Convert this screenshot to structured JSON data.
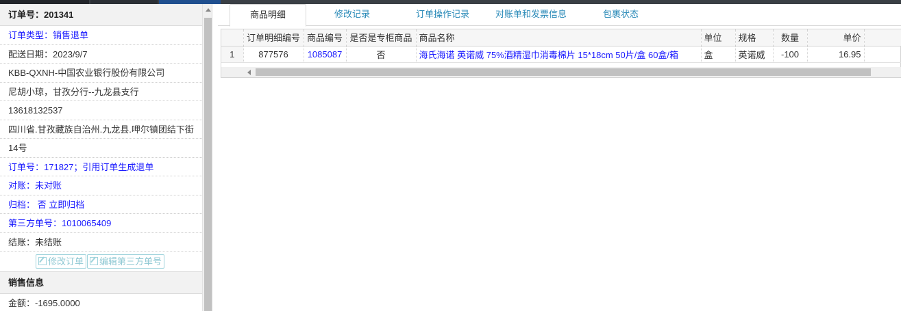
{
  "order_panel": {
    "header": "订单号：201341",
    "rows": [
      {
        "text": "订单类型：销售退单",
        "blue": true
      },
      {
        "text": "配送日期：2023/9/7",
        "blue": false
      },
      {
        "text": "KBB-QXNH-中国农业银行股份有限公司",
        "blue": false
      },
      {
        "text": "尼胡小琼，甘孜分行--九龙县支行",
        "blue": false
      },
      {
        "text": "13618132537",
        "blue": false
      },
      {
        "text": "四川省.甘孜藏族自治州.九龙县.呷尔镇团结下街",
        "blue": false
      },
      {
        "text": "14号",
        "blue": false
      },
      {
        "text": "订单号：171827；引用订单生成退单",
        "blue": true
      },
      {
        "text": "对账：未对账",
        "blue": true
      },
      {
        "text": "归档： 否 立即归档",
        "blue": true
      },
      {
        "text": "第三方单号：1010065409",
        "blue": true
      },
      {
        "text": "结账：未结账",
        "blue": false
      }
    ],
    "buttons": {
      "edit_order": "修改订单",
      "edit_third_party": "编辑第三方单号"
    }
  },
  "sales_panel": {
    "header": "销售信息",
    "amount": "金额：-1695.0000"
  },
  "tabs": [
    {
      "label": "商品明细",
      "active": true
    },
    {
      "label": "修改记录",
      "active": false
    },
    {
      "label": "订单操作记录",
      "active": false
    },
    {
      "label": "对账单和发票信息",
      "active": false
    },
    {
      "label": "包裹状态",
      "active": false
    }
  ],
  "grid": {
    "columns": [
      "订单明细编号",
      "商品编号",
      "是否是专柜商品",
      "商品名称",
      "单位",
      "规格",
      "数量",
      "单价"
    ],
    "rows": [
      {
        "row_num": "1",
        "detail_id": "877576",
        "product_id": "1085087",
        "is_counter": "否",
        "product_name": "海氏海诺 英诺威 75%酒精湿巾消毒棉片 15*18cm 50片/盒 60盒/箱",
        "unit": "盒",
        "spec": "英诺威",
        "quantity": "-100",
        "price": "16.95"
      }
    ]
  }
}
